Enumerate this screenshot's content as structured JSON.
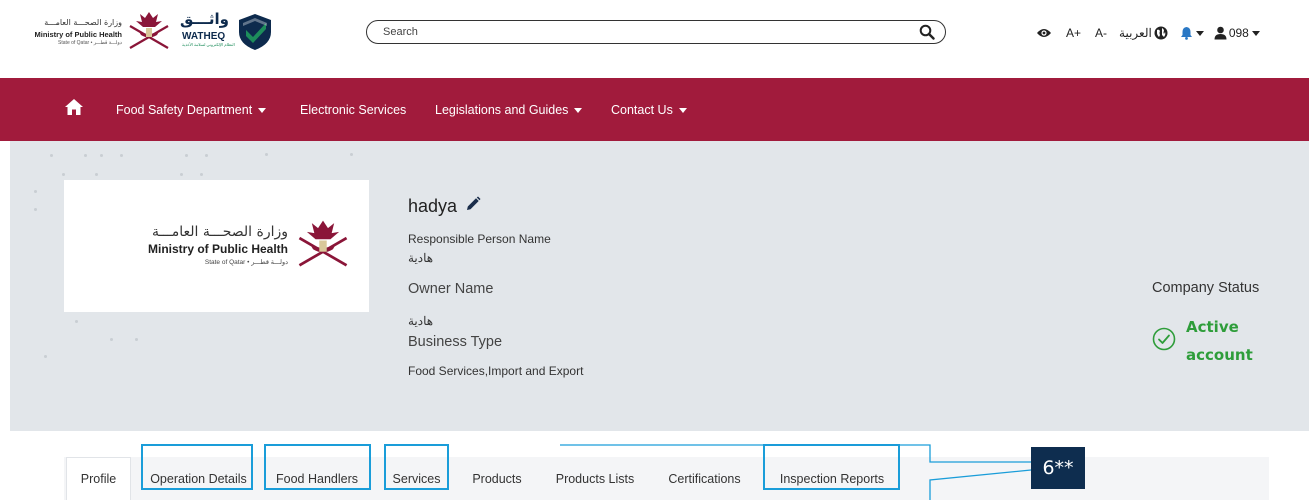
{
  "header": {
    "moph_logo": {
      "arabic": "وزارة الصحـــة العامـــة",
      "english": "Ministry of Public Health",
      "sub": "State of Qatar • دولـــة قطـــر"
    },
    "watheq_logo": {
      "arabic": "واثـــق",
      "english": "WATHEQ",
      "tag": "النظام الإلكتروني لسلامة الأغذية"
    },
    "search": {
      "placeholder": "Search",
      "value": ""
    },
    "accessibility": {
      "increase": "A+",
      "decrease": "A-"
    },
    "language": "العربية",
    "user": "098"
  },
  "nav": {
    "items": [
      {
        "label": "Food Safety Department",
        "dropdown": true
      },
      {
        "label": "Electronic Services",
        "dropdown": false
      },
      {
        "label": "Legislations and Guides",
        "dropdown": true
      },
      {
        "label": "Contact Us",
        "dropdown": true
      }
    ]
  },
  "profile": {
    "card_logo": {
      "arabic": "وزارة الصحـــة العامـــة",
      "english": "Ministry of Public Health",
      "sub": "State of Qatar • دولـــة قطـــر"
    },
    "company_name": "hadya",
    "responsible_person_label": "Responsible Person Name",
    "responsible_person_value": "هادية",
    "owner_label": "Owner Name",
    "owner_value": "هادية",
    "business_type_label": "Business Type",
    "business_type_value": "Food Services,Import and Export",
    "status_label": "Company Status",
    "status_value": "Active account"
  },
  "tabs": [
    {
      "label": "Profile",
      "active": true,
      "highlighted": false
    },
    {
      "label": "Operation Details",
      "active": false,
      "highlighted": true
    },
    {
      "label": "Food Handlers",
      "active": false,
      "highlighted": true
    },
    {
      "label": "Services",
      "active": false,
      "highlighted": true
    },
    {
      "label": "Products",
      "active": false,
      "highlighted": false
    },
    {
      "label": "Products Lists",
      "active": false,
      "highlighted": false
    },
    {
      "label": "Certifications",
      "active": false,
      "highlighted": false
    },
    {
      "label": "Inspection Reports",
      "active": false,
      "highlighted": true
    }
  ],
  "callout": {
    "text": "6**"
  },
  "colors": {
    "nav_bg": "#a11b3c",
    "banner_bg": "#e2e6ea",
    "status_green": "#2e9d3a",
    "highlight_blue": "#1a9dd9",
    "callout_bg": "#0e2d4f"
  }
}
